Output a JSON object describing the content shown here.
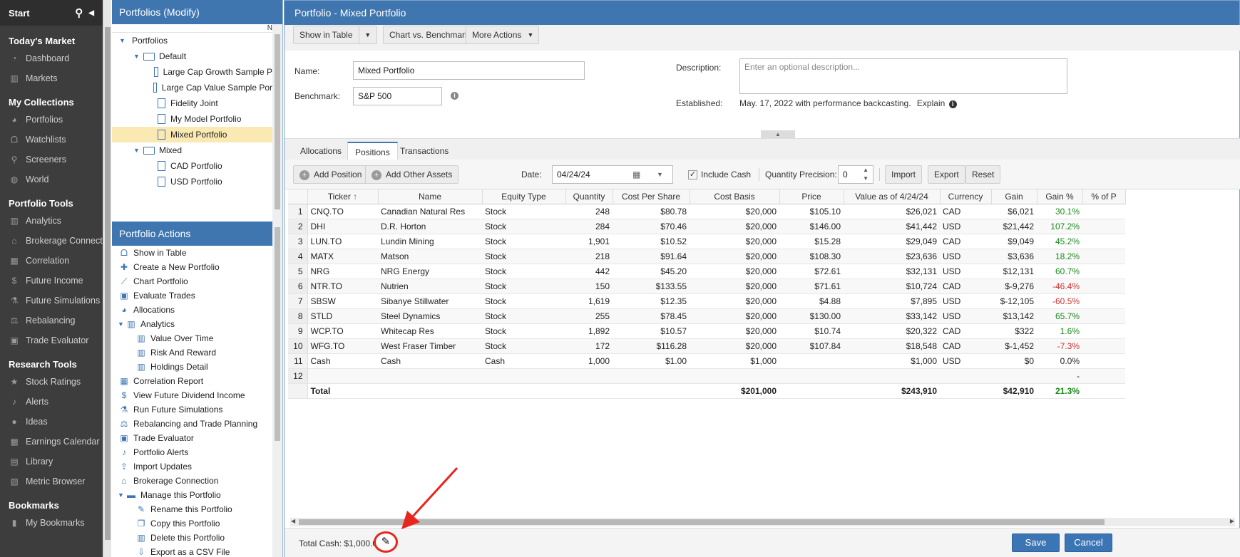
{
  "nav": {
    "start": "Start",
    "sections": [
      {
        "title": "Today's Market",
        "items": [
          {
            "label": "Dashboard",
            "icon": "dashboard-icon",
            "glyph": "◔"
          },
          {
            "label": "Markets",
            "icon": "bar-chart-icon",
            "glyph": "▥"
          }
        ]
      },
      {
        "title": "My Collections",
        "items": [
          {
            "label": "Portfolios",
            "icon": "pie-chart-icon",
            "glyph": "◕"
          },
          {
            "label": "Watchlists",
            "icon": "binoculars-icon",
            "glyph": "ᗝ"
          },
          {
            "label": "Screeners",
            "icon": "search-icon",
            "glyph": "⚲"
          },
          {
            "label": "World",
            "icon": "globe-icon",
            "glyph": "◍"
          }
        ]
      },
      {
        "title": "Portfolio Tools",
        "items": [
          {
            "label": "Analytics",
            "icon": "bar-chart-icon",
            "glyph": "▥"
          },
          {
            "label": "Brokerage Connect",
            "icon": "bank-icon",
            "glyph": "⌂"
          },
          {
            "label": "Correlation",
            "icon": "grid-icon",
            "glyph": "▦"
          },
          {
            "label": "Future Income",
            "icon": "dollar-icon",
            "glyph": "$"
          },
          {
            "label": "Future Simulations",
            "icon": "flask-icon",
            "glyph": "⚗"
          },
          {
            "label": "Rebalancing",
            "icon": "scale-icon",
            "glyph": "⚖"
          },
          {
            "label": "Trade Evaluator",
            "icon": "briefcase-icon",
            "glyph": "▣"
          }
        ]
      },
      {
        "title": "Research Tools",
        "items": [
          {
            "label": "Stock Ratings",
            "icon": "star-icon",
            "glyph": "★"
          },
          {
            "label": "Alerts",
            "icon": "bell-icon",
            "glyph": "♪"
          },
          {
            "label": "Ideas",
            "icon": "lightbulb-icon",
            "glyph": "●"
          },
          {
            "label": "Earnings Calendar",
            "icon": "calendar-icon",
            "glyph": "▦"
          },
          {
            "label": "Library",
            "icon": "book-icon",
            "glyph": "▤"
          },
          {
            "label": "Metric Browser",
            "icon": "table-icon",
            "glyph": "▧"
          }
        ]
      },
      {
        "title": "Bookmarks",
        "items": [
          {
            "label": "My Bookmarks",
            "icon": "bookmark-icon",
            "glyph": "▮"
          }
        ]
      }
    ]
  },
  "portfolios_panel": {
    "title": "Portfolios (Modify)",
    "col_hint": "N",
    "tree": [
      {
        "label": "Portfolios",
        "level": 0,
        "kind": "root"
      },
      {
        "label": "Default",
        "level": 1,
        "kind": "folder"
      },
      {
        "label": "Large Cap Growth Sample P",
        "level": 2,
        "kind": "doc"
      },
      {
        "label": "Large Cap Value Sample Por",
        "level": 2,
        "kind": "doc"
      },
      {
        "label": "Fidelity Joint",
        "level": 2,
        "kind": "doc"
      },
      {
        "label": "My Model Portfolio",
        "level": 2,
        "kind": "doc"
      },
      {
        "label": "Mixed Portfolio",
        "level": 2,
        "kind": "doc",
        "selected": true
      },
      {
        "label": "Mixed",
        "level": 1,
        "kind": "folder"
      },
      {
        "label": "CAD Portfolio",
        "level": 2,
        "kind": "doc"
      },
      {
        "label": "USD Portfolio",
        "level": 2,
        "kind": "doc"
      }
    ],
    "actions_title": "Portfolio Actions",
    "actions": [
      {
        "label": "Show in Table",
        "level": 0,
        "icon": "binoculars-icon",
        "glyph": "ᗝ"
      },
      {
        "label": "Create a New Portfolio",
        "level": 0,
        "icon": "plus-icon",
        "glyph": "✚"
      },
      {
        "label": "Chart Portfolio",
        "level": 0,
        "icon": "line-chart-icon",
        "glyph": "⟋"
      },
      {
        "label": "Evaluate Trades",
        "level": 0,
        "icon": "briefcase-icon",
        "glyph": "▣"
      },
      {
        "label": "Allocations",
        "level": 0,
        "icon": "pie-chart-icon",
        "glyph": "◕"
      },
      {
        "label": "Analytics",
        "level": 0,
        "icon": "bar-chart-icon",
        "glyph": "▥",
        "expand": true
      },
      {
        "label": "Value Over Time",
        "level": 1,
        "icon": "bar-chart-icon",
        "glyph": "▥"
      },
      {
        "label": "Risk And Reward",
        "level": 1,
        "icon": "bar-chart-icon",
        "glyph": "▥"
      },
      {
        "label": "Holdings Detail",
        "level": 1,
        "icon": "bar-chart-icon",
        "glyph": "▥"
      },
      {
        "label": "Correlation Report",
        "level": 0,
        "icon": "grid-icon",
        "glyph": "▦"
      },
      {
        "label": "View Future Dividend Income",
        "level": 0,
        "icon": "dollar-icon",
        "glyph": "$"
      },
      {
        "label": "Run Future Simulations",
        "level": 0,
        "icon": "flask-icon",
        "glyph": "⚗"
      },
      {
        "label": "Rebalancing and Trade Planning",
        "level": 0,
        "icon": "scale-icon",
        "glyph": "⚖"
      },
      {
        "label": "Trade Evaluator",
        "level": 0,
        "icon": "briefcase-icon",
        "glyph": "▣"
      },
      {
        "label": "Portfolio Alerts",
        "level": 0,
        "icon": "bell-icon",
        "glyph": "♪"
      },
      {
        "label": "Import Updates",
        "level": 0,
        "icon": "upload-icon",
        "glyph": "⇪"
      },
      {
        "label": "Brokerage Connection",
        "level": 0,
        "icon": "bank-icon",
        "glyph": "⌂"
      },
      {
        "label": "Manage this Portfolio",
        "level": 0,
        "icon": "folder-icon",
        "glyph": "▬",
        "expand": true
      },
      {
        "label": "Rename this Portfolio",
        "level": 1,
        "icon": "edit-icon",
        "glyph": "✎"
      },
      {
        "label": "Copy this Portfolio",
        "level": 1,
        "icon": "copy-icon",
        "glyph": "❐"
      },
      {
        "label": "Delete this Portfolio",
        "level": 1,
        "icon": "trash-icon",
        "glyph": "▥"
      },
      {
        "label": "Export as a CSV File",
        "level": 1,
        "icon": "download-icon",
        "glyph": "⇩"
      }
    ]
  },
  "main": {
    "title": "Portfolio - Mixed Portfolio",
    "toolbar": {
      "show_table": "Show in Table",
      "chart_benchmark": "Chart vs. Benchmark",
      "more_actions": "More Actions"
    },
    "form": {
      "name_label": "Name:",
      "name_value": "Mixed Portfolio",
      "benchmark_label": "Benchmark:",
      "benchmark_value": "S&P 500",
      "description_label": "Description:",
      "description_placeholder": "Enter an optional description...",
      "established_label": "Established:",
      "established_value": "May. 17, 2022 with performance backcasting.",
      "explain": "Explain"
    },
    "tabs": [
      "Allocations",
      "Positions",
      "Transactions"
    ],
    "active_tab": "Positions",
    "positions_toolbar": {
      "add_position": "Add Position",
      "add_other": "Add Other Assets",
      "date_label": "Date:",
      "date_value": "04/24/24",
      "include_cash": "Include Cash",
      "precision_label": "Quantity Precision:",
      "precision_value": "0",
      "import": "Import",
      "export": "Export",
      "reset": "Reset"
    },
    "columns": [
      "",
      "Ticker",
      "Name",
      "Equity Type",
      "Quantity",
      "Cost Per Share",
      "Cost Basis",
      "Price",
      "Value as of 4/24/24",
      "Currency",
      "Gain",
      "Gain %",
      "% of P"
    ],
    "rows": [
      [
        "1",
        "CNQ.TO",
        "Canadian Natural Res",
        "Stock",
        "248",
        "$80.78",
        "$20,000",
        "$105.10",
        "$26,021",
        "CAD",
        "$6,021",
        "30.1%"
      ],
      [
        "2",
        "DHI",
        "D.R. Horton",
        "Stock",
        "284",
        "$70.46",
        "$20,000",
        "$146.00",
        "$41,442",
        "USD",
        "$21,442",
        "107.2%"
      ],
      [
        "3",
        "LUN.TO",
        "Lundin Mining",
        "Stock",
        "1,901",
        "$10.52",
        "$20,000",
        "$15.28",
        "$29,049",
        "CAD",
        "$9,049",
        "45.2%"
      ],
      [
        "4",
        "MATX",
        "Matson",
        "Stock",
        "218",
        "$91.64",
        "$20,000",
        "$108.30",
        "$23,636",
        "USD",
        "$3,636",
        "18.2%"
      ],
      [
        "5",
        "NRG",
        "NRG Energy",
        "Stock",
        "442",
        "$45.20",
        "$20,000",
        "$72.61",
        "$32,131",
        "USD",
        "$12,131",
        "60.7%"
      ],
      [
        "6",
        "NTR.TO",
        "Nutrien",
        "Stock",
        "150",
        "$133.55",
        "$20,000",
        "$71.61",
        "$10,724",
        "CAD",
        "$-9,276",
        "-46.4%"
      ],
      [
        "7",
        "SBSW",
        "Sibanye Stillwater",
        "Stock",
        "1,619",
        "$12.35",
        "$20,000",
        "$4.88",
        "$7,895",
        "USD",
        "$-12,105",
        "-60.5%"
      ],
      [
        "8",
        "STLD",
        "Steel Dynamics",
        "Stock",
        "255",
        "$78.45",
        "$20,000",
        "$130.00",
        "$33,142",
        "USD",
        "$13,142",
        "65.7%"
      ],
      [
        "9",
        "WCP.TO",
        "Whitecap Res",
        "Stock",
        "1,892",
        "$10.57",
        "$20,000",
        "$10.74",
        "$20,322",
        "CAD",
        "$322",
        "1.6%"
      ],
      [
        "10",
        "WFG.TO",
        "West Fraser Timber",
        "Stock",
        "172",
        "$116.28",
        "$20,000",
        "$107.84",
        "$18,548",
        "CAD",
        "$-1,452",
        "-7.3%"
      ],
      [
        "11",
        "Cash",
        "Cash",
        "Cash",
        "1,000",
        "$1.00",
        "$1,000",
        "",
        "$1,000",
        "USD",
        "$0",
        "0.0%"
      ],
      [
        "12",
        "",
        "",
        "",
        "",
        "",
        "",
        "",
        "",
        "",
        "",
        "-"
      ]
    ],
    "total": {
      "label": "Total",
      "cost_basis": "$201,000",
      "value": "$243,910",
      "gain": "$42,910",
      "gain_pct": "21.3%"
    },
    "footer": {
      "total_cash": "Total Cash: $1,000.00",
      "save": "Save",
      "cancel": "Cancel"
    },
    "annotation_color": "#e8261c"
  }
}
